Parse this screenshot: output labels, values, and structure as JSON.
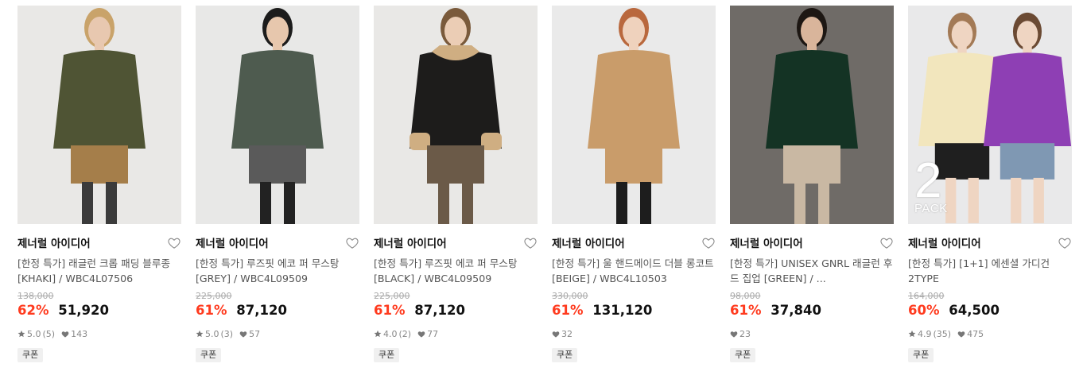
{
  "products": [
    {
      "brand": "제너럴 아이디어",
      "title": "[한정 특가] 래글런 크롭 패딩 블루종 [KHAKI] / WBC4L07506",
      "original_price": "138,000",
      "discount": "62%",
      "price": "51,920",
      "rating": "5.0",
      "review_count": "(5)",
      "likes": "143",
      "coupon": "쿠폰",
      "image": {
        "bg": "#e9e8e6",
        "top": "#4f5434",
        "bottom": "#a57e4a",
        "skin": "#e8c8b0",
        "hair": "#c9a36a",
        "legs": "#3b3b3b"
      }
    },
    {
      "brand": "제너럴 아이디어",
      "title": "[한정 특가] 루즈핏 에코 퍼 무스탕 [GREY] / WBC4L09509",
      "original_price": "225,000",
      "discount": "61%",
      "price": "87,120",
      "rating": "5.0",
      "review_count": "(3)",
      "likes": "57",
      "coupon": "쿠폰",
      "image": {
        "bg": "#e8e8e7",
        "top": "#4e5b4f",
        "bottom": "#5a5a5a",
        "skin": "#e7c7ad",
        "hair": "#1c1c1c",
        "legs": "#222222"
      }
    },
    {
      "brand": "제너럴 아이디어",
      "title": "[한정 특가] 루즈핏 에코 퍼 무스탕 [BLACK] / WBC4L09509",
      "original_price": "225,000",
      "discount": "61%",
      "price": "87,120",
      "rating": "4.0",
      "review_count": "(2)",
      "likes": "77",
      "coupon": "쿠폰",
      "image": {
        "bg": "#e9e8e6",
        "top": "#1d1c1b",
        "bottom": "#6b5a48",
        "skin": "#ebcdb5",
        "hair": "#7a5a3b",
        "legs": "#6b5a48",
        "trim": "#cfae82"
      }
    },
    {
      "brand": "제너럴 아이디어",
      "title": "[한정 특가] 울 핸드메이드 더블 롱코트 [BEIGE] / WBC4L10503",
      "original_price": "330,000",
      "discount": "61%",
      "price": "131,120",
      "rating": "",
      "review_count": "",
      "likes": "32",
      "coupon": "쿠폰",
      "image": {
        "bg": "#eaeaea",
        "top": "#c99c6a",
        "bottom": "#c99c6a",
        "skin": "#efd2bd",
        "hair": "#b9683d",
        "legs": "#1d1d1d"
      }
    },
    {
      "brand": "제너럴 아이디어",
      "title": "[한정 특가] UNISEX GNRL 래글런 후드 집업 [GREEN] / ...",
      "original_price": "98,000",
      "discount": "61%",
      "price": "37,840",
      "rating": "",
      "review_count": "",
      "likes": "23",
      "coupon": "쿠폰",
      "image": {
        "bg": "#6f6b67",
        "top": "#143324",
        "bottom": "#c9b8a3",
        "skin": "#d9b59b",
        "hair": "#1d1713",
        "legs": "#c9b8a3"
      }
    },
    {
      "brand": "제너럴 아이디어",
      "title": "[한정 특가] [1+1] 에센셜 가디건 2TYPE",
      "original_price": "164,000",
      "discount": "60%",
      "price": "64,500",
      "rating": "4.9",
      "review_count": "(35)",
      "likes": "475",
      "coupon": "쿠폰",
      "pack_number": "2",
      "pack_text": "PACK",
      "image": {
        "bg": "#e9e9ea",
        "top": "#f2e6bd",
        "bottom": "#1f1f1f",
        "skin": "#efd5c2",
        "hair": "#a37a56",
        "legs": "#efd5c2",
        "top2": "#8e3fb4",
        "bottom2": "#7f98b3"
      }
    }
  ],
  "colors": {
    "discount": "#ff3b1f",
    "star": "#777777",
    "heart": "#888888"
  },
  "icons": [
    "heart-outline-icon",
    "star-icon",
    "heart-filled-icon"
  ]
}
